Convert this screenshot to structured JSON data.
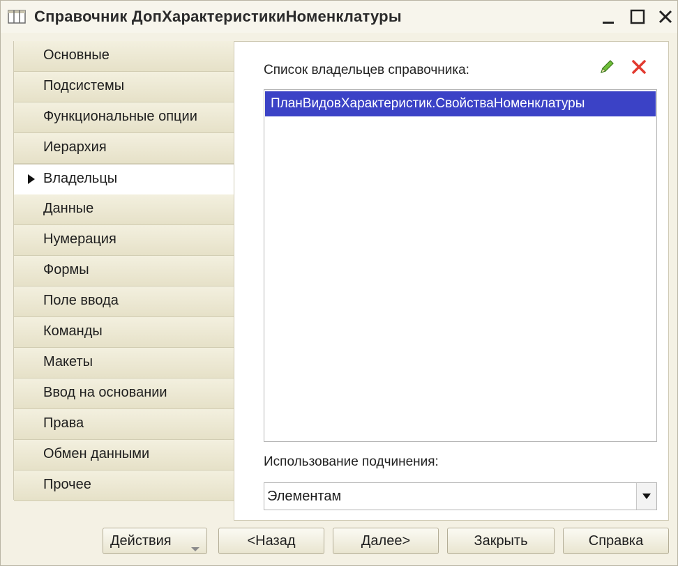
{
  "window": {
    "title": "Справочник ДопХарактеристикиНоменклатуры",
    "minimize_icon": "minimize-icon",
    "maximize_icon": "maximize-icon",
    "close_icon": "close-icon"
  },
  "sidebar": {
    "active_index": 4,
    "items": [
      {
        "label": "Основные"
      },
      {
        "label": "Подсистемы"
      },
      {
        "label": "Функциональные опции"
      },
      {
        "label": "Иерархия"
      },
      {
        "label": "Владельцы"
      },
      {
        "label": "Данные"
      },
      {
        "label": "Нумерация"
      },
      {
        "label": "Формы"
      },
      {
        "label": "Поле ввода"
      },
      {
        "label": "Команды"
      },
      {
        "label": "Макеты"
      },
      {
        "label": "Ввод на основании"
      },
      {
        "label": "Права"
      },
      {
        "label": "Обмен данными"
      },
      {
        "label": "Прочее"
      }
    ]
  },
  "owners": {
    "label": "Список владельцев справочника:",
    "edit_icon": "pencil-icon",
    "delete_icon": "red-x-icon",
    "items": [
      "ПланВидовХарактеристик.СвойстваНоменклатуры"
    ],
    "selected_color": "#3b42c6"
  },
  "subordination": {
    "label": "Использование подчинения:",
    "value": "Элементам"
  },
  "footer": {
    "actions": "Действия",
    "back": "<Назад",
    "next": "Далее>",
    "close": "Закрыть",
    "help": "Справка"
  }
}
